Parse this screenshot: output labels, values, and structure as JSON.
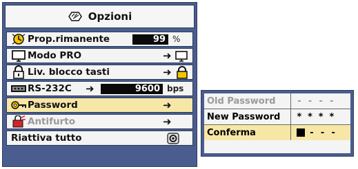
{
  "menu": {
    "title": "Opzioni",
    "title_icon": "options-icon",
    "items": [
      {
        "label": "Prop.rimanente",
        "icon": "lamp-timer-icon",
        "value": "99",
        "unit": "%"
      },
      {
        "label": "Modo PRO",
        "icon": "monitor-icon",
        "arrow": "➜"
      },
      {
        "label": "Liv. blocco tasti",
        "icon": "lock-icon",
        "arrow": "➜"
      },
      {
        "label": "RS-232C",
        "icon": "serial-port-icon",
        "arrow": "➜",
        "value": "9600",
        "unit": "bps"
      },
      {
        "label": "Password",
        "icon": "key-icon",
        "arrow": "➜",
        "selected": true
      },
      {
        "label": "Antifurto",
        "icon": "antitheft-icon",
        "arrow": "➜",
        "disabled": true
      },
      {
        "label": "Riattiva tutto",
        "icon": "reset-icon"
      }
    ]
  },
  "password_panel": {
    "rows": [
      {
        "label": "Old Password",
        "value": "- - - -",
        "dimmed": true
      },
      {
        "label": "New Password",
        "value": "* * * *"
      },
      {
        "label": "Conferma",
        "value": "- - -",
        "selected": true
      }
    ]
  },
  "colors": {
    "frame": "#4a5d8e",
    "selected_row": "#f7e7a6",
    "row_bg": "#f4f4f4"
  }
}
